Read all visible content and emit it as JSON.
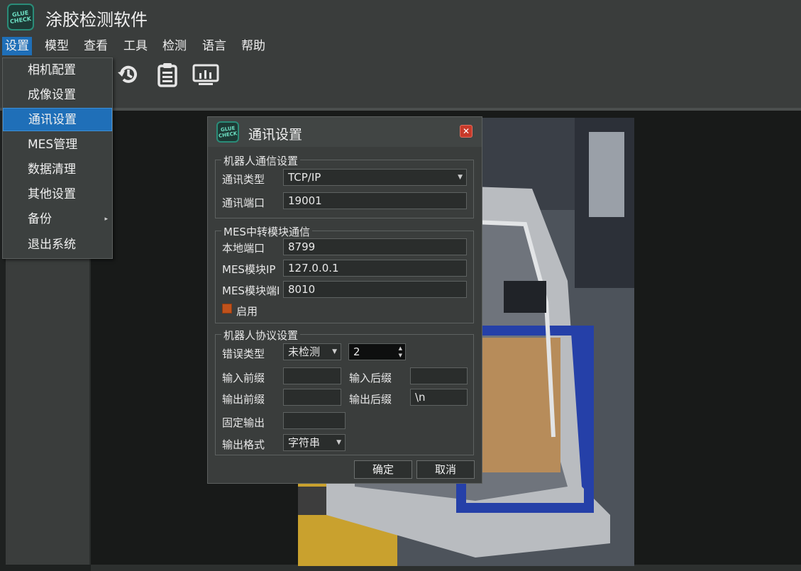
{
  "app": {
    "title": "涂胶检测软件",
    "logo_text": [
      "GLUE",
      "CHECK"
    ]
  },
  "menubar": {
    "items": [
      "设置",
      "模型",
      "查看",
      "工具",
      "检测",
      "语言",
      "帮助"
    ]
  },
  "toolbar": {
    "icons": [
      "history-icon",
      "clipboard-icon",
      "monitor-chart-icon"
    ]
  },
  "settings_menu": {
    "items": [
      "相机配置",
      "成像设置",
      "通讯设置",
      "MES管理",
      "数据清理",
      "其他设置",
      "备份",
      "退出系统"
    ],
    "active_index": 2,
    "submenu_arrow": "▸"
  },
  "dialog": {
    "title": "通讯设置",
    "close_glyph": "✕",
    "robot_comm": {
      "group_title": "机器人通信设置",
      "type_label": "通讯类型",
      "type_value": "TCP/IP",
      "port_label": "通讯端口",
      "port_value": "19001"
    },
    "mes": {
      "group_title": "MES中转模块通信",
      "local_port_label": "本地端口",
      "local_port_value": "8799",
      "ip_label": "MES模块IP",
      "ip_value": "127.0.0.1",
      "port_label": "MES模块端I",
      "port_value": "8010",
      "enable_label": "启用",
      "enable_color": "#c0521c"
    },
    "protocol": {
      "group_title": "机器人协议设置",
      "error_type_label": "错误类型",
      "error_type_value": "未检测",
      "error_code_value": "2",
      "input_prefix_label": "输入前缀",
      "input_prefix_value": "",
      "input_suffix_label": "输入后缀",
      "input_suffix_value": "",
      "output_prefix_label": "输出前缀",
      "output_prefix_value": "",
      "output_suffix_label": "输出后缀",
      "output_suffix_value": "\\n",
      "fixed_output_label": "固定输出",
      "fixed_output_value": "",
      "output_format_label": "输出格式",
      "output_format_value": "字符串"
    },
    "buttons": {
      "ok": "确定",
      "cancel": "取消"
    }
  },
  "colors": {
    "accent": "#1f6fb8",
    "panel": "#3a3d3c",
    "canvas": "#181a19"
  }
}
